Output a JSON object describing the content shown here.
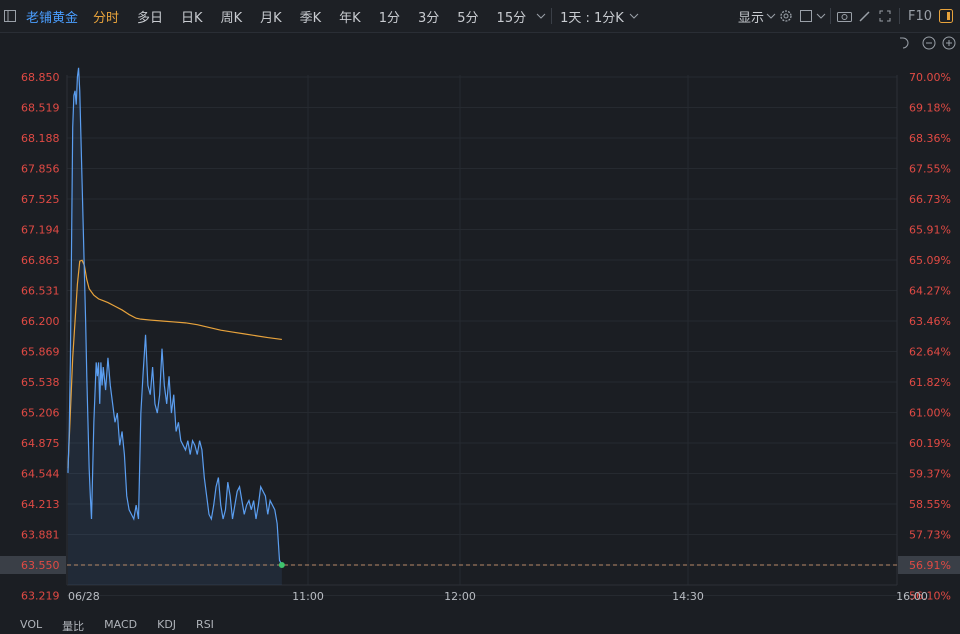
{
  "toolbar": {
    "stock_name": "老铺黄金",
    "tabs": [
      "分时",
      "多日",
      "日K",
      "周K",
      "月K",
      "季K",
      "年K",
      "1分",
      "3分",
      "5分",
      "15分"
    ],
    "active_tab": "分时",
    "interval_select": "1天 : 1分K",
    "display_label": "显示",
    "f10_label": "F10"
  },
  "chart_data": {
    "type": "line",
    "price_ticks": [
      "68.850",
      "68.519",
      "68.188",
      "67.856",
      "67.525",
      "67.194",
      "66.863",
      "66.531",
      "66.200",
      "65.869",
      "65.538",
      "65.206",
      "64.875",
      "64.544",
      "64.213",
      "63.881",
      "63.550",
      "63.219"
    ],
    "percent_ticks": [
      "70.00%",
      "69.18%",
      "68.36%",
      "67.55%",
      "66.73%",
      "65.91%",
      "65.09%",
      "64.27%",
      "63.46%",
      "62.64%",
      "61.82%",
      "61.00%",
      "60.19%",
      "59.37%",
      "58.55%",
      "57.73%",
      "56.91%",
      "56.10%"
    ],
    "x_ticks": [
      "06/28",
      "11:00",
      "12:00",
      "14:30",
      "16:00"
    ],
    "current_price": "63.550",
    "current_percent": "56.91%",
    "ylim": [
      63.05,
      69.1
    ],
    "price_series": [
      [
        0,
        64.55
      ],
      [
        0.5,
        65.0
      ],
      [
        1,
        65.75
      ],
      [
        1.5,
        67.0
      ],
      [
        2,
        68.3
      ],
      [
        2.5,
        68.65
      ],
      [
        3,
        68.7
      ],
      [
        3.5,
        68.55
      ],
      [
        4,
        68.85
      ],
      [
        4.5,
        68.95
      ],
      [
        5,
        68.7
      ],
      [
        5.5,
        68.2
      ],
      [
        6,
        67.7
      ],
      [
        6.5,
        67.2
      ],
      [
        7,
        66.7
      ],
      [
        7.5,
        66.2
      ],
      [
        8,
        65.6
      ],
      [
        8.5,
        65.1
      ],
      [
        9,
        64.6
      ],
      [
        9.5,
        64.3
      ],
      [
        10,
        64.05
      ],
      [
        11,
        65.1
      ],
      [
        12,
        65.75
      ],
      [
        12.5,
        65.6
      ],
      [
        13,
        65.75
      ],
      [
        13.5,
        65.3
      ],
      [
        14,
        65.75
      ],
      [
        14.5,
        65.5
      ],
      [
        15,
        65.7
      ],
      [
        16,
        65.45
      ],
      [
        17,
        65.8
      ],
      [
        18,
        65.5
      ],
      [
        19,
        65.3
      ],
      [
        20,
        65.1
      ],
      [
        21,
        65.2
      ],
      [
        22,
        64.85
      ],
      [
        23,
        65.0
      ],
      [
        24,
        64.75
      ],
      [
        25,
        64.3
      ],
      [
        26,
        64.15
      ],
      [
        27,
        64.1
      ],
      [
        28,
        64.05
      ],
      [
        29,
        64.2
      ],
      [
        30,
        64.05
      ],
      [
        31,
        65.2
      ],
      [
        32,
        65.65
      ],
      [
        33,
        66.05
      ],
      [
        34,
        65.5
      ],
      [
        35,
        65.4
      ],
      [
        36,
        65.7
      ],
      [
        37,
        65.3
      ],
      [
        38,
        65.2
      ],
      [
        39,
        65.4
      ],
      [
        40,
        65.9
      ],
      [
        41,
        65.5
      ],
      [
        42,
        65.3
      ],
      [
        43,
        65.6
      ],
      [
        44,
        65.2
      ],
      [
        45,
        65.4
      ],
      [
        46,
        65.0
      ],
      [
        47,
        65.1
      ],
      [
        48,
        64.9
      ],
      [
        49,
        64.85
      ],
      [
        50,
        64.8
      ],
      [
        51,
        64.9
      ],
      [
        52,
        64.75
      ],
      [
        53,
        64.9
      ],
      [
        54,
        64.85
      ],
      [
        55,
        64.75
      ],
      [
        56,
        64.9
      ],
      [
        57,
        64.8
      ],
      [
        58,
        64.5
      ],
      [
        59,
        64.3
      ],
      [
        60,
        64.1
      ],
      [
        61,
        64.05
      ],
      [
        62,
        64.2
      ],
      [
        63,
        64.4
      ],
      [
        64,
        64.5
      ],
      [
        65,
        64.2
      ],
      [
        66,
        64.05
      ],
      [
        67,
        64.15
      ],
      [
        68,
        64.45
      ],
      [
        69,
        64.3
      ],
      [
        70,
        64.05
      ],
      [
        71,
        64.2
      ],
      [
        72,
        64.35
      ],
      [
        73,
        64.4
      ],
      [
        74,
        64.25
      ],
      [
        75,
        64.1
      ],
      [
        76,
        64.2
      ],
      [
        77,
        64.25
      ],
      [
        78,
        64.15
      ],
      [
        79,
        64.25
      ],
      [
        80,
        64.05
      ],
      [
        81,
        64.2
      ],
      [
        82,
        64.4
      ],
      [
        83,
        64.35
      ],
      [
        84,
        64.3
      ],
      [
        85,
        64.1
      ],
      [
        86,
        64.25
      ],
      [
        87,
        64.2
      ],
      [
        88,
        64.15
      ],
      [
        89,
        64.0
      ],
      [
        90,
        63.6
      ],
      [
        91,
        63.55
      ]
    ],
    "avg_series": [
      [
        0,
        64.6
      ],
      [
        2,
        65.8
      ],
      [
        4,
        66.6
      ],
      [
        5,
        66.85
      ],
      [
        6,
        66.86
      ],
      [
        7,
        66.8
      ],
      [
        8,
        66.65
      ],
      [
        9,
        66.55
      ],
      [
        11,
        66.48
      ],
      [
        13,
        66.44
      ],
      [
        15,
        66.42
      ],
      [
        17,
        66.4
      ],
      [
        20,
        66.36
      ],
      [
        23,
        66.32
      ],
      [
        26,
        66.27
      ],
      [
        29,
        66.23
      ],
      [
        31,
        66.22
      ],
      [
        35,
        66.21
      ],
      [
        40,
        66.2
      ],
      [
        45,
        66.19
      ],
      [
        50,
        66.18
      ],
      [
        55,
        66.16
      ],
      [
        60,
        66.13
      ],
      [
        65,
        66.1
      ],
      [
        70,
        66.08
      ],
      [
        75,
        66.06
      ],
      [
        80,
        66.04
      ],
      [
        85,
        66.02
      ],
      [
        91,
        66.0
      ]
    ],
    "colors": {
      "price": "#5b9ef0",
      "avg": "#e8a33c",
      "axis_text": "#e04a44",
      "last_dot": "#3ec46d"
    }
  },
  "bottom_tabs": [
    "VOL",
    "量比",
    "MACD",
    "KDJ",
    "RSI"
  ]
}
